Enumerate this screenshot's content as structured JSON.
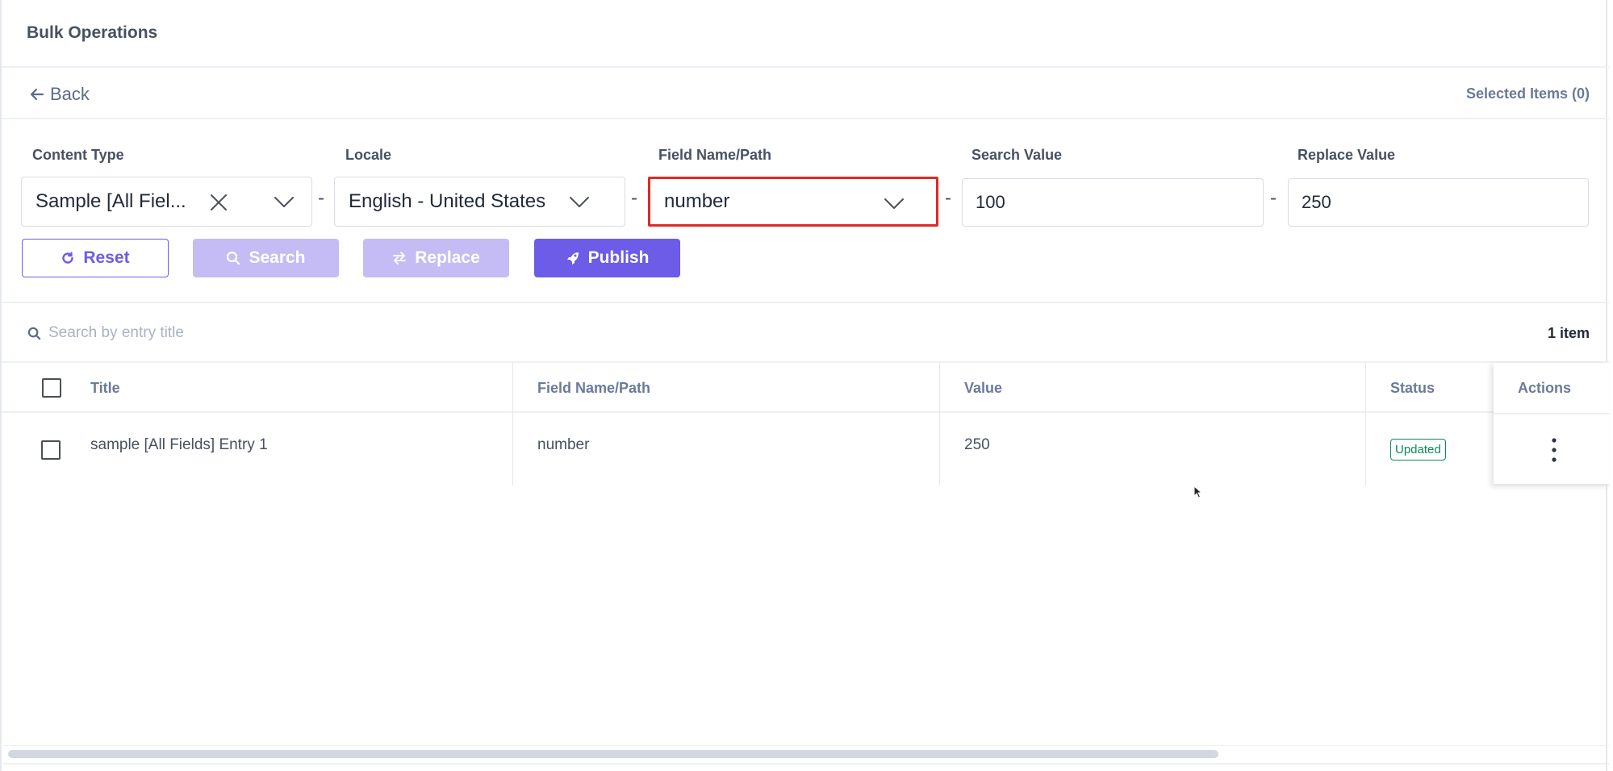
{
  "header": {
    "title": "Bulk Operations"
  },
  "nav": {
    "back_label": "Back",
    "selected_items": "Selected Items (0)"
  },
  "filters": {
    "content_type": {
      "label": "Content Type",
      "value": "Sample [All Fiel..."
    },
    "locale": {
      "label": "Locale",
      "value": "English - United States"
    },
    "field_name": {
      "label": "Field Name/Path",
      "value": "number"
    },
    "search_value": {
      "label": "Search Value",
      "value": "100"
    },
    "replace_value": {
      "label": "Replace Value",
      "value": "250"
    },
    "separator": "-"
  },
  "buttons": {
    "reset": "Reset",
    "search": "Search",
    "replace": "Replace",
    "publish": "Publish"
  },
  "entry_search": {
    "placeholder": "Search by entry title",
    "count": "1 item"
  },
  "table": {
    "headers": {
      "title": "Title",
      "field": "Field Name/Path",
      "value": "Value",
      "status": "Status",
      "actions": "Actions"
    },
    "rows": [
      {
        "title": "sample [All Fields] Entry 1",
        "field": "number",
        "value": "250",
        "status": "Updated"
      }
    ]
  },
  "colors": {
    "accent": "#6c5ce7",
    "accent_disabled": "#c5bcf5",
    "highlight": "#dc2b25",
    "status_green": "#0a8a58"
  },
  "icons": [
    "arrow-left-icon",
    "close-icon",
    "chevron-down-icon",
    "refresh-icon",
    "search-icon",
    "swap-icon",
    "rocket-icon",
    "kebab-icon"
  ]
}
